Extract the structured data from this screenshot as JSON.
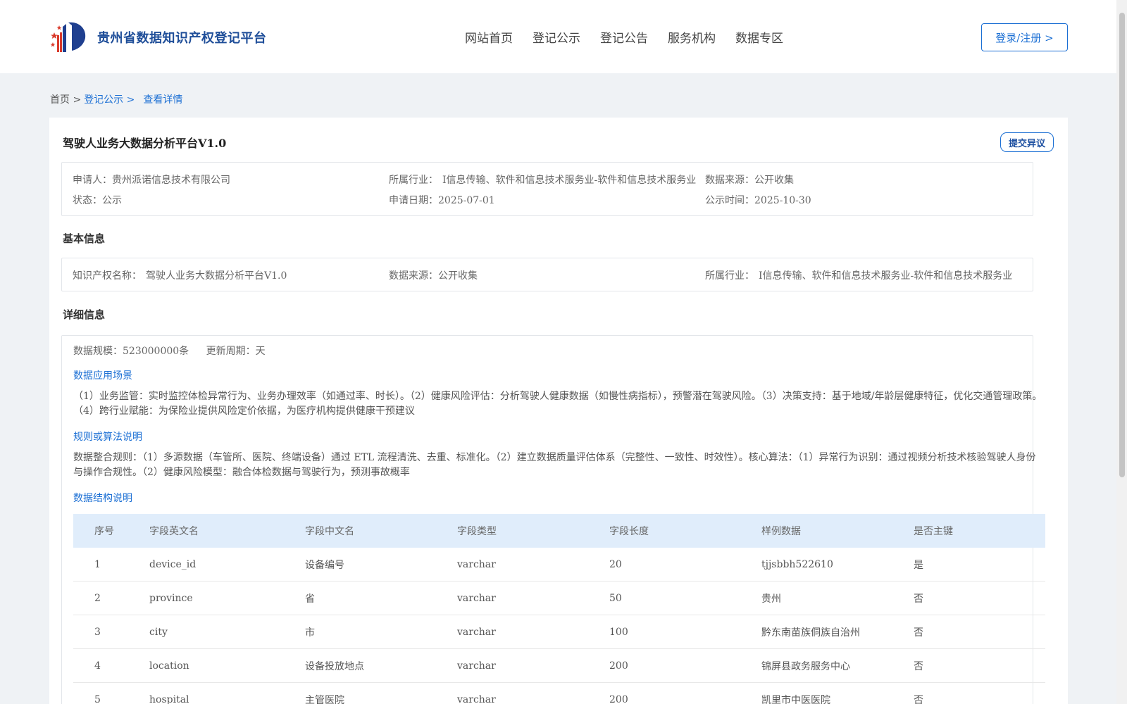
{
  "header": {
    "site_title": "贵州省数据知识产权登记平台",
    "nav": [
      "网站首页",
      "登记公示",
      "登记公告",
      "服务机构",
      "数据专区"
    ],
    "login_label": "登录/注册 >"
  },
  "breadcrumb": {
    "home": "首页 >",
    "parent": "登记公示 >",
    "current": "查看详情"
  },
  "record": {
    "title": "驾驶人业务大数据分析平台V1.0",
    "objection_label": "提交异议",
    "summary": {
      "applicant_label": "申请人：",
      "applicant": "贵州派诺信息技术有限公司",
      "industry_label": "所属行业：",
      "industry": "I信息传输、软件和信息技术服务业-软件和信息技术服务业",
      "source_label": "数据来源：",
      "source": "公开收集",
      "status_label": "状态：",
      "status": "公示",
      "apply_date_label": "申请日期：",
      "apply_date": "2025-07-01",
      "publish_time_label": "公示时间：",
      "publish_time": "2025-10-30"
    },
    "basic": {
      "section_title": "基本信息",
      "ip_name_label": "知识产权名称：",
      "ip_name": "驾驶人业务大数据分析平台V1.0",
      "source_label": "数据来源：",
      "source": "公开收集",
      "industry_label": "所属行业：",
      "industry": "I信息传输、软件和信息技术服务业-软件和信息技术服务业"
    },
    "detail": {
      "section_title": "详细信息",
      "scale_label": "数据规模：",
      "scale": "523000000条",
      "cycle_label": "更新周期：",
      "cycle": "天",
      "scenario_title": "数据应用场景",
      "scenario_text": "（1）业务监管：实时监控体检异常行为、业务办理效率（如通过率、时长）。（2）健康风险评估：分析驾驶人健康数据（如慢性病指标），预警潜在驾驶风险。（3）决策支持：基于地域/年龄层健康特征，优化交通管理政策。（4）跨行业赋能：为保险业提供风险定价依据，为医疗机构提供健康干预建议",
      "rules_title": "规则或算法说明",
      "rules_text": "数据整合规则：（1）多源数据（车管所、医院、终端设备）通过 ETL 流程清洗、去重、标准化。（2）建立数据质量评估体系（完整性、一致性、时效性）。核心算法：（1）异常行为识别：通过视频分析技术核验驾驶人身份与操作合规性。（2）健康风险模型：融合体检数据与驾驶行为，预测事故概率",
      "structure_title": "数据结构说明"
    },
    "table": {
      "headers": [
        "序号",
        "字段英文名",
        "字段中文名",
        "字段类型",
        "字段长度",
        "样例数据",
        "是否主键"
      ],
      "rows": [
        [
          "1",
          "device_id",
          "设备编号",
          "varchar",
          "20",
          "tjjsbbh522610",
          "是"
        ],
        [
          "2",
          "province",
          "省",
          "varchar",
          "50",
          "贵州",
          "否"
        ],
        [
          "3",
          "city",
          "市",
          "varchar",
          "100",
          "黔东南苗族侗族自治州",
          "否"
        ],
        [
          "4",
          "location",
          "设备投放地点",
          "varchar",
          "200",
          "锦屏县政务服务中心",
          "否"
        ],
        [
          "5",
          "hospital",
          "主管医院",
          "varchar",
          "200",
          "凯里市中医医院",
          "否"
        ]
      ]
    }
  },
  "colors": {
    "brand_blue": "#1b6fd4",
    "title_blue": "#1f4e99",
    "table_header_bg": "#e0edfb",
    "page_bg": "#eff2f5"
  },
  "icons": {
    "logo": "platform-logo-icon"
  }
}
